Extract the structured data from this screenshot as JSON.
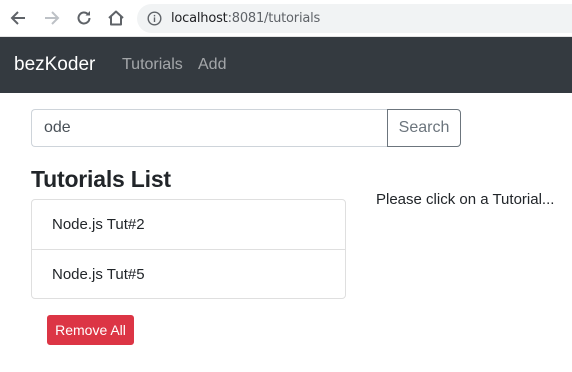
{
  "browser": {
    "url_host": "localhost",
    "url_rest": ":8081/tutorials",
    "icons": [
      "back-icon",
      "forward-icon",
      "reload-icon",
      "home-icon",
      "info-icon"
    ]
  },
  "navbar": {
    "brand": "bezKoder",
    "links": [
      {
        "label": "Tutorials"
      },
      {
        "label": "Add"
      }
    ]
  },
  "search": {
    "value": "ode",
    "button_label": "Search"
  },
  "list": {
    "title": "Tutorials List",
    "items": [
      {
        "title": "Node.js Tut#2"
      },
      {
        "title": "Node.js Tut#5"
      }
    ],
    "remove_all_label": "Remove All"
  },
  "detail": {
    "hint": "Please click on a Tutorial..."
  },
  "colors": {
    "navbar_bg": "#343a40",
    "danger": "#dc3545",
    "secondary": "#6c757d"
  }
}
